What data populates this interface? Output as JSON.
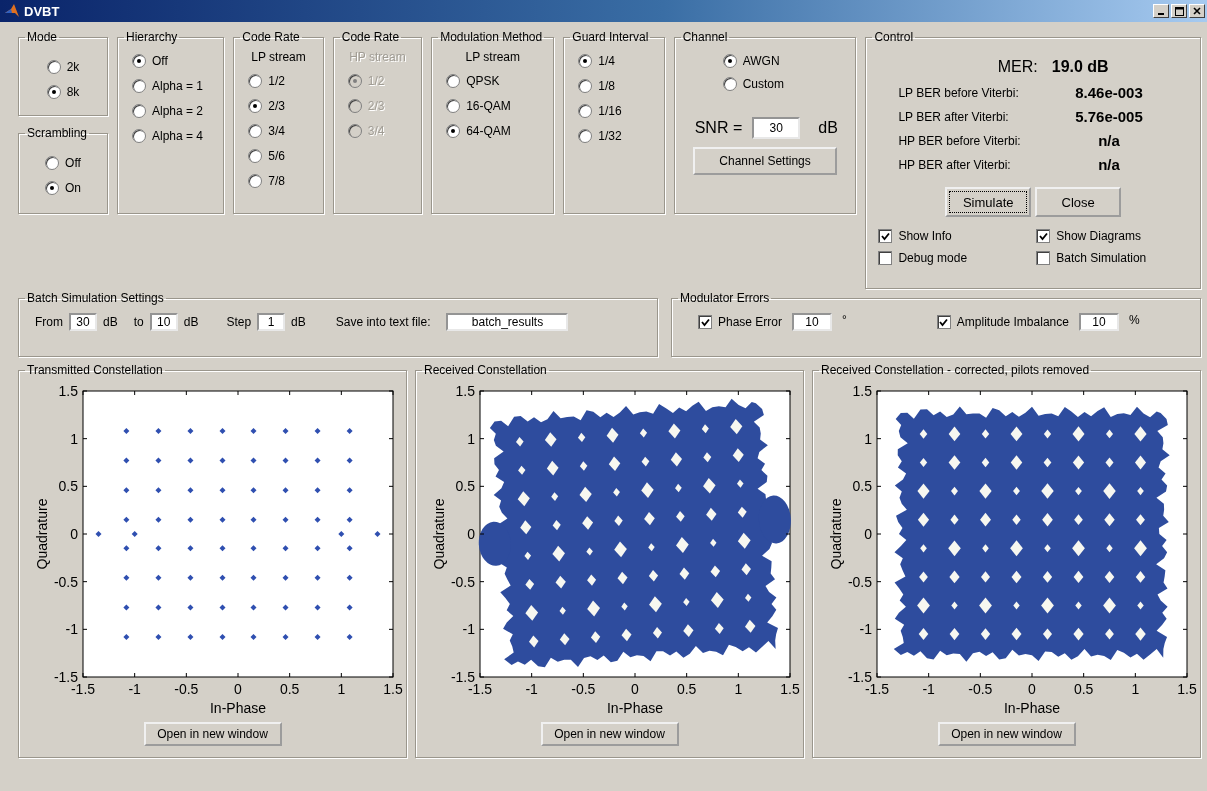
{
  "window": {
    "title": "DVBT"
  },
  "radio_groups": [
    {
      "title": "Mode",
      "options": [
        {
          "label": "2k",
          "selected": false
        },
        {
          "label": "8k",
          "selected": true
        }
      ]
    },
    {
      "title": "Scrambling",
      "options": [
        {
          "label": "Off",
          "selected": false
        },
        {
          "label": "On",
          "selected": true
        }
      ]
    },
    {
      "title": "Hierarchy",
      "options": [
        {
          "label": "Off",
          "selected": true
        },
        {
          "label": "Alpha = 1",
          "selected": false
        },
        {
          "label": "Alpha = 2",
          "selected": false
        },
        {
          "label": "Alpha = 4",
          "selected": false
        }
      ]
    },
    {
      "title": "Code Rate",
      "subtitle": "LP stream",
      "options": [
        {
          "label": "1/2",
          "selected": false
        },
        {
          "label": "2/3",
          "selected": true
        },
        {
          "label": "3/4",
          "selected": false
        },
        {
          "label": "5/6",
          "selected": false
        },
        {
          "label": "7/8",
          "selected": false
        }
      ]
    },
    {
      "title": "Code Rate",
      "subtitle": "HP stream",
      "disabled": true,
      "options": [
        {
          "label": "1/2",
          "selected": true
        },
        {
          "label": "2/3",
          "selected": false
        },
        {
          "label": "3/4",
          "selected": false
        }
      ]
    },
    {
      "title": "Modulation Method",
      "subtitle": "LP stream",
      "options": [
        {
          "label": "QPSK",
          "selected": false
        },
        {
          "label": "16-QAM",
          "selected": false
        },
        {
          "label": "64-QAM",
          "selected": true
        }
      ]
    },
    {
      "title": "Guard Interval",
      "options": [
        {
          "label": "1/4",
          "selected": true
        },
        {
          "label": "1/8",
          "selected": false
        },
        {
          "label": "1/16",
          "selected": false
        },
        {
          "label": "1/32",
          "selected": false
        }
      ]
    }
  ],
  "channel": {
    "title": "Channel",
    "options": [
      {
        "label": "AWGN",
        "selected": true
      },
      {
        "label": "Custom",
        "selected": false
      }
    ],
    "snr_label": "SNR =",
    "snr_value": "30",
    "snr_unit": "dB",
    "button": "Channel Settings"
  },
  "control": {
    "title": "Control",
    "mer_label": "MER:",
    "mer_value": "19.0 dB",
    "stats": [
      {
        "label": "LP BER before Viterbi:",
        "value": "8.46e-003"
      },
      {
        "label": "LP BER after Viterbi:",
        "value": "5.76e-005"
      },
      {
        "label": "HP BER before Viterbi:",
        "value": "n/a"
      },
      {
        "label": "HP BER after Viterbi:",
        "value": "n/a"
      }
    ],
    "buttons": [
      {
        "label": "Simulate",
        "focused": true
      },
      {
        "label": "Close",
        "focused": false
      }
    ],
    "checkboxes": [
      {
        "label": "Show Info",
        "checked": true
      },
      {
        "label": "Show Diagrams",
        "checked": true
      },
      {
        "label": "Debug mode",
        "checked": false
      },
      {
        "label": "Batch Simulation",
        "checked": false
      }
    ]
  },
  "batch": {
    "title": "Batch Simulation Settings",
    "fields": [
      {
        "label": "From",
        "value": "30",
        "unit": "dB"
      },
      {
        "label": "to",
        "value": "10",
        "unit": "dB"
      },
      {
        "label": "Step",
        "value": "1",
        "unit": "dB"
      }
    ],
    "file_label": "Save into text file:",
    "file_value": "batch_results"
  },
  "modulator_errors": {
    "title": "Modulator Errors",
    "items": [
      {
        "label": "Phase Error",
        "checked": true,
        "value": "10",
        "unit": "°"
      },
      {
        "label": "Amplitude Imbalance",
        "checked": true,
        "value": "10",
        "unit": "%"
      }
    ]
  },
  "plots": [
    {
      "title": "Transmitted Constellation",
      "kind": "scatter",
      "button": "Open in new window",
      "chart_data": {
        "type": "scatter",
        "xlabel": "In-Phase",
        "ylabel": "Quadrature",
        "xlim": [
          -1.5,
          1.5
        ],
        "ylim": [
          -1.5,
          1.5
        ],
        "xticks": [
          -1.5,
          -1,
          -0.5,
          0,
          0.5,
          1,
          1.5
        ],
        "yticks": [
          1.5,
          1,
          0.5,
          0,
          -0.5,
          -1,
          -1.5
        ],
        "x": [
          -1.08,
          -0.77,
          -0.46,
          -0.15,
          0.15,
          0.46,
          0.77,
          1.08,
          -1.08,
          -0.77,
          -0.46,
          -0.15,
          0.15,
          0.46,
          0.77,
          1.08,
          -1.08,
          -0.77,
          -0.46,
          -0.15,
          0.15,
          0.46,
          0.77,
          1.08,
          -1.08,
          -0.77,
          -0.46,
          -0.15,
          0.15,
          0.46,
          0.77,
          1.08,
          -1.35,
          -1,
          1,
          1.35,
          -1.08,
          -0.77,
          -0.46,
          -0.15,
          0.15,
          0.46,
          0.77,
          1.08,
          -1.08,
          -0.77,
          -0.46,
          -0.15,
          0.15,
          0.46,
          0.77,
          1.08,
          -1.08,
          -0.77,
          -0.46,
          -0.15,
          0.15,
          0.46,
          0.77,
          1.08,
          -1.08,
          -0.77,
          -0.46,
          -0.15,
          0.15,
          0.46,
          0.77,
          1.08
        ],
        "series": [
          {
            "color": "#2f4fb0",
            "values": [
              1.08,
              1.08,
              1.08,
              1.08,
              1.08,
              1.08,
              1.08,
              1.08,
              0.77,
              0.77,
              0.77,
              0.77,
              0.77,
              0.77,
              0.77,
              0.77,
              0.46,
              0.46,
              0.46,
              0.46,
              0.46,
              0.46,
              0.46,
              0.46,
              0.15,
              0.15,
              0.15,
              0.15,
              0.15,
              0.15,
              0.15,
              0.15,
              0,
              0,
              0,
              0,
              -0.15,
              -0.15,
              -0.15,
              -0.15,
              -0.15,
              -0.15,
              -0.15,
              -0.15,
              -0.46,
              -0.46,
              -0.46,
              -0.46,
              -0.46,
              -0.46,
              -0.46,
              -0.46,
              -0.77,
              -0.77,
              -0.77,
              -0.77,
              -0.77,
              -0.77,
              -0.77,
              -0.77,
              -1.08,
              -1.08,
              -1.08,
              -1.08,
              -1.08,
              -1.08,
              -1.08,
              -1.08
            ]
          }
        ]
      }
    },
    {
      "title": "Received Constellation",
      "kind": "skewed",
      "button": "Open in new window",
      "xlabel": "In-Phase",
      "ylabel": "Quadrature",
      "xticks": [
        "-1.5",
        "-1",
        "-0.5",
        "0",
        "0.5",
        "1",
        "1.5"
      ],
      "yticks": [
        "1.5",
        "1",
        "0.5",
        "0",
        "-0.5",
        "-1",
        "-1.5"
      ]
    },
    {
      "title": "Received Constellation - corrected, pilots removed",
      "kind": "cloud",
      "button": "Open in new window",
      "xlabel": "In-Phase",
      "ylabel": "Quadrature",
      "xticks": [
        "-1.5",
        "-1",
        "-0.5",
        "0",
        "0.5",
        "1",
        "1.5"
      ],
      "yticks": [
        "1.5",
        "1",
        "0.5",
        "0",
        "-0.5",
        "-1",
        "-1.5"
      ]
    }
  ]
}
